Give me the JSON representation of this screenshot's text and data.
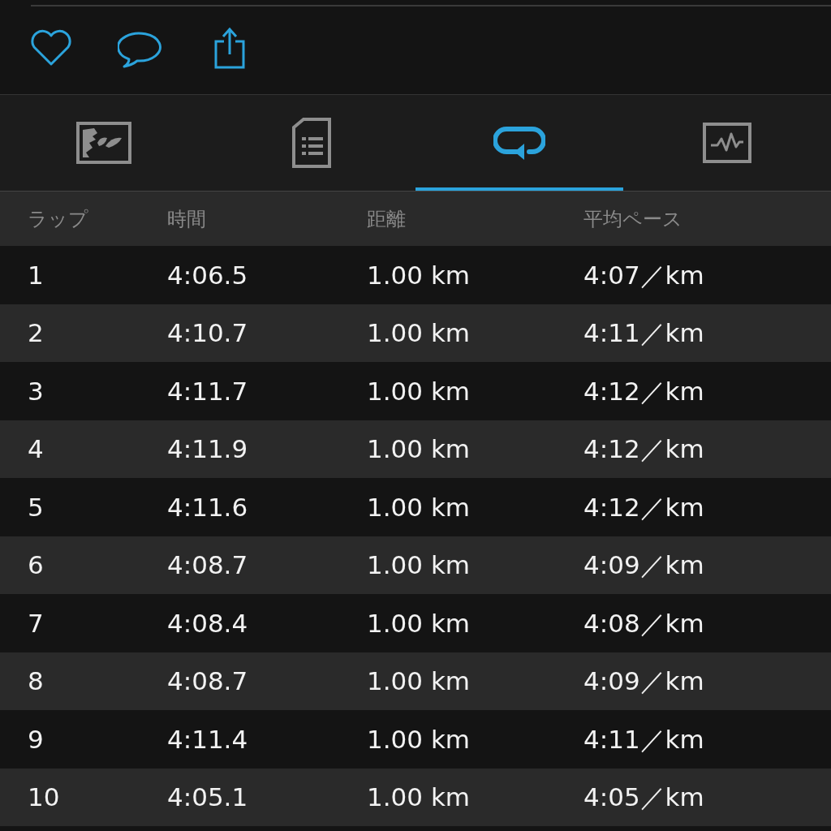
{
  "tabs": [
    {
      "selected": false
    },
    {
      "selected": false
    },
    {
      "selected": true
    },
    {
      "selected": false
    }
  ],
  "table": {
    "columns": [
      "ラップ",
      "時間",
      "距離",
      "平均ペース"
    ],
    "rows": [
      [
        "1",
        "4:06.5",
        "1.00 km",
        "4:07／km"
      ],
      [
        "2",
        "4:10.7",
        "1.00 km",
        "4:11／km"
      ],
      [
        "3",
        "4:11.7",
        "1.00 km",
        "4:12／km"
      ],
      [
        "4",
        "4:11.9",
        "1.00 km",
        "4:12／km"
      ],
      [
        "5",
        "4:11.6",
        "1.00 km",
        "4:12／km"
      ],
      [
        "6",
        "4:08.7",
        "1.00 km",
        "4:09／km"
      ],
      [
        "7",
        "4:08.4",
        "1.00 km",
        "4:08／km"
      ],
      [
        "8",
        "4:08.7",
        "1.00 km",
        "4:09／km"
      ],
      [
        "9",
        "4:11.4",
        "1.00 km",
        "4:11／km"
      ],
      [
        "10",
        "4:05.1",
        "1.00 km",
        "4:05／km"
      ]
    ]
  }
}
